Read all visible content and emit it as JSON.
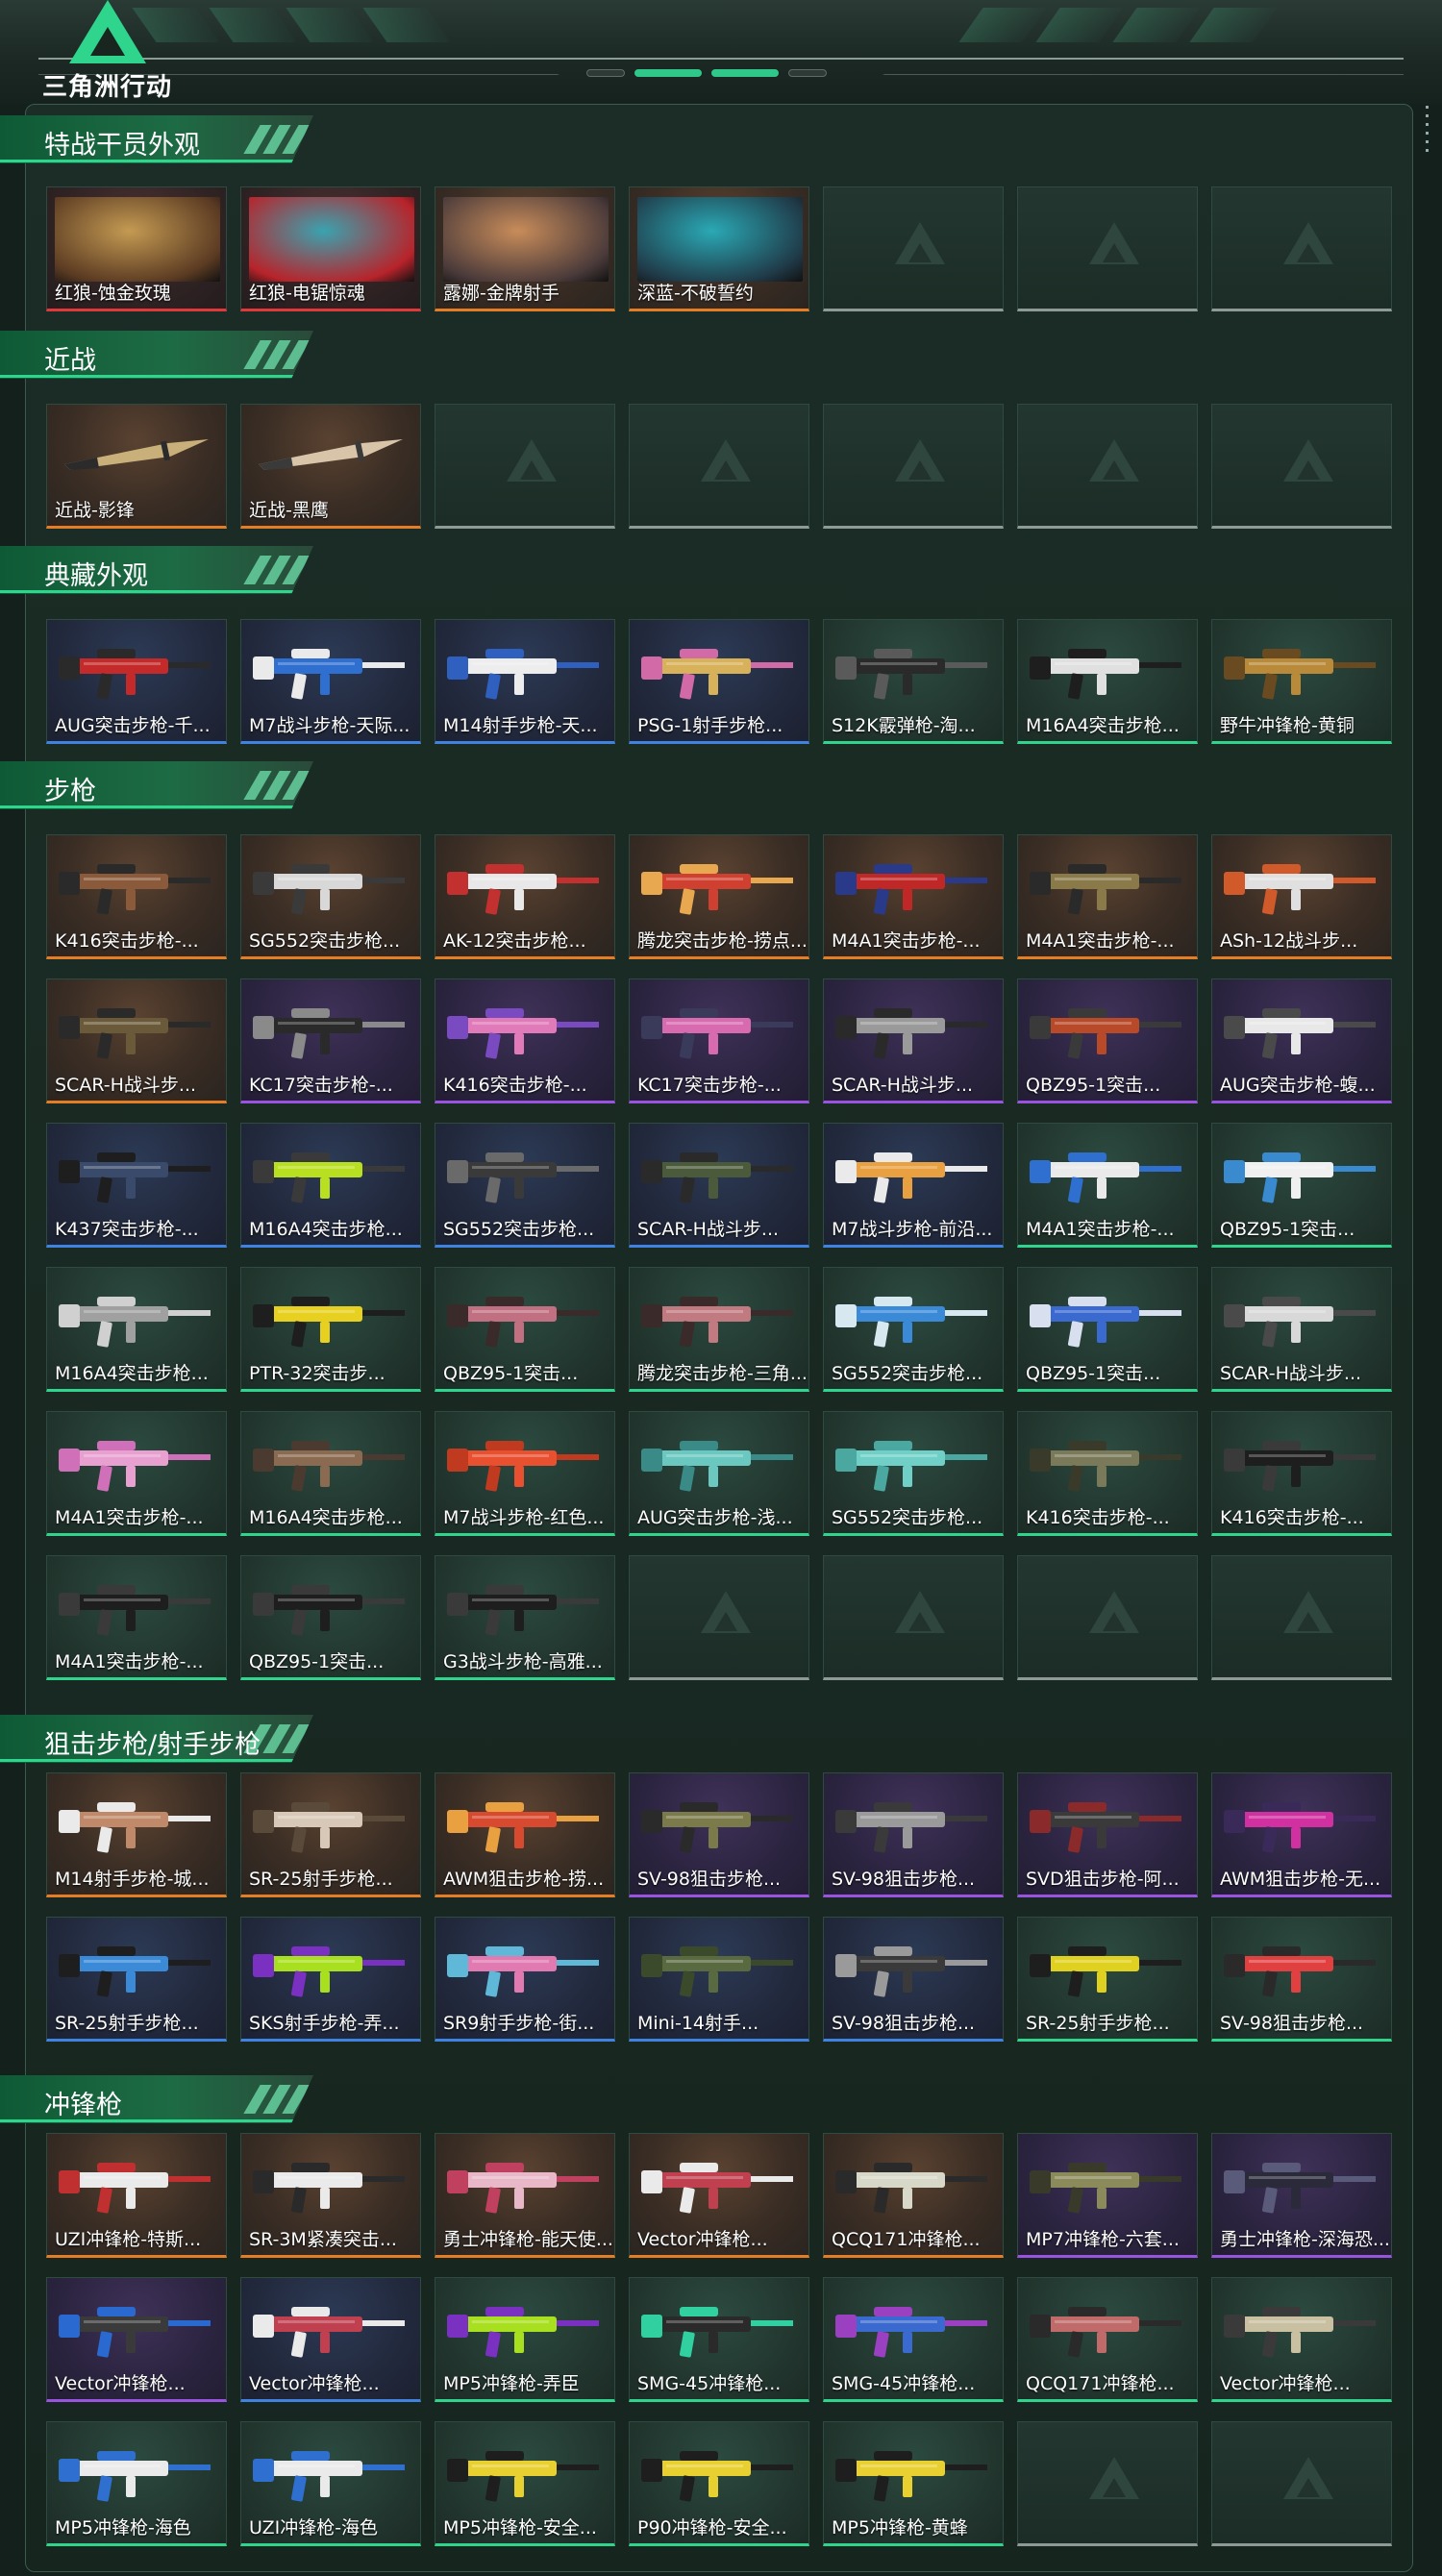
{
  "app": {
    "logo_text": "三角洲行动"
  },
  "sections": [
    {
      "title": "特战干员外观",
      "items": [
        {
          "label": "红狼-蚀金玫瑰",
          "rarity": "red",
          "kind": "operator",
          "colors": [
            "#c49a52",
            "#5a3a22"
          ]
        },
        {
          "label": "红狼-电锯惊魂",
          "rarity": "red",
          "kind": "operator",
          "colors": [
            "#3aa3b0",
            "#b8232a"
          ]
        },
        {
          "label": "露娜-金牌射手",
          "rarity": "orange",
          "kind": "operator",
          "colors": [
            "#c88c5a",
            "#4a3a3a"
          ]
        },
        {
          "label": "深蓝-不破誓约",
          "rarity": "orange",
          "kind": "operator",
          "colors": [
            "#2aa9b5",
            "#203a48"
          ]
        },
        {
          "label": "",
          "rarity": "empty"
        },
        {
          "label": "",
          "rarity": "empty"
        },
        {
          "label": "",
          "rarity": "empty"
        }
      ]
    },
    {
      "title": "近战",
      "items": [
        {
          "label": "近战-影锋",
          "rarity": "orange",
          "kind": "knife",
          "colors": [
            "#c9b07a",
            "#2b2b2b"
          ]
        },
        {
          "label": "近战-黑鹰",
          "rarity": "orange",
          "kind": "knife",
          "colors": [
            "#d8c4a8",
            "#3a3a3a"
          ]
        },
        {
          "label": "",
          "rarity": "empty"
        },
        {
          "label": "",
          "rarity": "empty"
        },
        {
          "label": "",
          "rarity": "empty"
        },
        {
          "label": "",
          "rarity": "empty"
        },
        {
          "label": "",
          "rarity": "empty"
        }
      ]
    },
    {
      "title": "典藏外观",
      "items": [
        {
          "label": "AUG突击步枪-千...",
          "rarity": "blue",
          "kind": "gun",
          "colors": [
            "#c42a2a",
            "#2a2a2a"
          ]
        },
        {
          "label": "M7战斗步枪-天际...",
          "rarity": "blue",
          "kind": "gun",
          "colors": [
            "#2f6fd0",
            "#eaeaea"
          ]
        },
        {
          "label": "M14射手步枪-天...",
          "rarity": "blue",
          "kind": "gun",
          "colors": [
            "#ededed",
            "#2f5fbf"
          ]
        },
        {
          "label": "PSG-1射手步枪...",
          "rarity": "blue",
          "kind": "gun",
          "colors": [
            "#d8b25a",
            "#d36aa8"
          ]
        },
        {
          "label": "S12K霰弹枪-淘...",
          "rarity": "green",
          "kind": "gun",
          "colors": [
            "#2a2a2a",
            "#5a5a5a"
          ]
        },
        {
          "label": "M16A4突击步枪...",
          "rarity": "green",
          "kind": "gun",
          "colors": [
            "#e0e0e0",
            "#1e1e1e"
          ]
        },
        {
          "label": "野牛冲锋枪-黄铜",
          "rarity": "green",
          "kind": "gun",
          "colors": [
            "#b88a3a",
            "#6a4a20"
          ]
        }
      ]
    },
    {
      "title": "步枪",
      "items": [
        {
          "label": "K416突击步枪-...",
          "rarity": "orange",
          "kind": "gun",
          "colors": [
            "#8a5a3a",
            "#2a2a2a"
          ]
        },
        {
          "label": "SG552突击步枪...",
          "rarity": "orange",
          "kind": "gun",
          "colors": [
            "#d8d8d8",
            "#3a3a3a"
          ]
        },
        {
          "label": "AK-12突击步枪...",
          "rarity": "orange",
          "kind": "gun",
          "colors": [
            "#e8e8e8",
            "#c23030"
          ]
        },
        {
          "label": "腾龙突击步枪-捞点...",
          "rarity": "orange",
          "kind": "gun",
          "colors": [
            "#d04030",
            "#e8a850"
          ]
        },
        {
          "label": "M4A1突击步枪-...",
          "rarity": "orange",
          "kind": "gun",
          "colors": [
            "#c02828",
            "#2a3a8a"
          ]
        },
        {
          "label": "M4A1突击步枪-...",
          "rarity": "orange",
          "kind": "gun",
          "colors": [
            "#8a7a4a",
            "#2a2a2a"
          ]
        },
        {
          "label": "ASh-12战斗步...",
          "rarity": "orange",
          "kind": "gun",
          "colors": [
            "#e0e0e0",
            "#d05a2a"
          ]
        },
        {
          "label": "SCAR-H战斗步...",
          "rarity": "orange",
          "kind": "gun",
          "colors": [
            "#6a5a3a",
            "#2a2a2a"
          ]
        },
        {
          "label": "KC17突击步枪-...",
          "rarity": "purple",
          "kind": "gun",
          "colors": [
            "#2a2a2a",
            "#8a8a8a"
          ]
        },
        {
          "label": "K416突击步枪-...",
          "rarity": "purple",
          "kind": "gun",
          "colors": [
            "#e07ab8",
            "#7a4ac0"
          ]
        },
        {
          "label": "KC17突击步枪-...",
          "rarity": "purple",
          "kind": "gun",
          "colors": [
            "#d86ab0",
            "#3a3a5a"
          ]
        },
        {
          "label": "SCAR-H战斗步...",
          "rarity": "purple",
          "kind": "gun",
          "colors": [
            "#9a9a9a",
            "#2a2a2a"
          ]
        },
        {
          "label": "QBZ95-1突击...",
          "rarity": "purple",
          "kind": "gun",
          "colors": [
            "#b84a2a",
            "#3a3a3a"
          ]
        },
        {
          "label": "AUG突击步枪-蝮...",
          "rarity": "purple",
          "kind": "gun",
          "colors": [
            "#e8e8e8",
            "#4a4a4a"
          ]
        },
        {
          "label": "K437突击步枪-...",
          "rarity": "blue",
          "kind": "gun",
          "colors": [
            "#3a4a6a",
            "#1e1e1e"
          ]
        },
        {
          "label": "M16A4突击步枪...",
          "rarity": "blue",
          "kind": "gun",
          "colors": [
            "#b8e020",
            "#3a3a3a"
          ]
        },
        {
          "label": "SG552突击步枪...",
          "rarity": "blue",
          "kind": "gun",
          "colors": [
            "#3a3a3a",
            "#6a6a6a"
          ]
        },
        {
          "label": "SCAR-H战斗步...",
          "rarity": "blue",
          "kind": "gun",
          "colors": [
            "#4a5a3a",
            "#2a2a2a"
          ]
        },
        {
          "label": "M7战斗步枪-前沿...",
          "rarity": "blue",
          "kind": "gun",
          "colors": [
            "#e8a040",
            "#eaeaea"
          ]
        },
        {
          "label": "M4A1突击步枪-...",
          "rarity": "green",
          "kind": "gun",
          "colors": [
            "#eaeaea",
            "#2f6fd0"
          ]
        },
        {
          "label": "QBZ95-1突击...",
          "rarity": "green",
          "kind": "gun",
          "colors": [
            "#f0f0f0",
            "#3a8ad0"
          ]
        },
        {
          "label": "M16A4突击步枪...",
          "rarity": "green",
          "kind": "gun",
          "colors": [
            "#a0a0a0",
            "#d0d0d0"
          ]
        },
        {
          "label": "PTR-32突击步...",
          "rarity": "green",
          "kind": "gun",
          "colors": [
            "#e8d020",
            "#1e1e1e"
          ]
        },
        {
          "label": "QBZ95-1突击...",
          "rarity": "green",
          "kind": "gun",
          "colors": [
            "#c07080",
            "#3a2a2a"
          ]
        },
        {
          "label": "腾龙突击步枪-三角...",
          "rarity": "green",
          "kind": "gun",
          "colors": [
            "#c07a80",
            "#3a2a2a"
          ]
        },
        {
          "label": "SG552突击步枪...",
          "rarity": "green",
          "kind": "gun",
          "colors": [
            "#3a8ad8",
            "#d8e8f0"
          ]
        },
        {
          "label": "QBZ95-1突击...",
          "rarity": "green",
          "kind": "gun",
          "colors": [
            "#3a6ad0",
            "#d8e0f0"
          ]
        },
        {
          "label": "SCAR-H战斗步...",
          "rarity": "green",
          "kind": "gun",
          "colors": [
            "#d8d8d8",
            "#4a4a4a"
          ]
        },
        {
          "label": "M4A1突击步枪-...",
          "rarity": "green",
          "kind": "gun",
          "colors": [
            "#e8a0d0",
            "#d070b8"
          ]
        },
        {
          "label": "M16A4突击步枪...",
          "rarity": "green",
          "kind": "gun",
          "colors": [
            "#8a6a50",
            "#4a3a30"
          ]
        },
        {
          "label": "M7战斗步枪-红色...",
          "rarity": "green",
          "kind": "gun",
          "colors": [
            "#e85030",
            "#c03a20"
          ]
        },
        {
          "label": "AUG突击步枪-浅...",
          "rarity": "green",
          "kind": "gun",
          "colors": [
            "#6ac8c0",
            "#3a8a88"
          ]
        },
        {
          "label": "SG552突击步枪...",
          "rarity": "green",
          "kind": "gun",
          "colors": [
            "#70d0c8",
            "#4aa8a0"
          ]
        },
        {
          "label": "K416突击步枪-...",
          "rarity": "green",
          "kind": "gun",
          "colors": [
            "#7a7a5a",
            "#3a3a2a"
          ]
        },
        {
          "label": "K416突击步枪-...",
          "rarity": "green",
          "kind": "gun",
          "colors": [
            "#1e1e1e",
            "#3a3a3a"
          ]
        },
        {
          "label": "M4A1突击步枪-...",
          "rarity": "green",
          "kind": "gun",
          "colors": [
            "#1e1e1e",
            "#3a3a3a"
          ]
        },
        {
          "label": "QBZ95-1突击...",
          "rarity": "green",
          "kind": "gun",
          "colors": [
            "#1e1e1e",
            "#3a3a3a"
          ]
        },
        {
          "label": "G3战斗步枪-高雅...",
          "rarity": "green",
          "kind": "gun",
          "colors": [
            "#1e1e1e",
            "#3a3a3a"
          ]
        },
        {
          "label": "",
          "rarity": "empty"
        },
        {
          "label": "",
          "rarity": "empty"
        },
        {
          "label": "",
          "rarity": "empty"
        },
        {
          "label": "",
          "rarity": "empty"
        }
      ]
    },
    {
      "title": "狙击步枪/射手步枪",
      "items": [
        {
          "label": "M14射手步枪-城...",
          "rarity": "orange",
          "kind": "gun",
          "colors": [
            "#c08a6a",
            "#eaeaea"
          ]
        },
        {
          "label": "SR-25射手步枪...",
          "rarity": "orange",
          "kind": "gun",
          "colors": [
            "#d8c8b8",
            "#5a4a3a"
          ]
        },
        {
          "label": "AWM狙击步枪-捞...",
          "rarity": "orange",
          "kind": "gun",
          "colors": [
            "#d84a30",
            "#e8a040"
          ]
        },
        {
          "label": "SV-98狙击步枪...",
          "rarity": "purple",
          "kind": "gun",
          "colors": [
            "#7a7a4a",
            "#2a2a2a"
          ]
        },
        {
          "label": "SV-98狙击步枪...",
          "rarity": "purple",
          "kind": "gun",
          "colors": [
            "#9a9a9a",
            "#3a3a3a"
          ]
        },
        {
          "label": "SVD狙击步枪-阿...",
          "rarity": "purple",
          "kind": "gun",
          "colors": [
            "#3a3a3a",
            "#8a2a2a"
          ]
        },
        {
          "label": "AWM狙击步枪-无...",
          "rarity": "purple",
          "kind": "gun",
          "colors": [
            "#d030a0",
            "#3a2a5a"
          ]
        },
        {
          "label": "SR-25射手步枪...",
          "rarity": "blue",
          "kind": "gun",
          "colors": [
            "#3a8ad8",
            "#1e1e1e"
          ]
        },
        {
          "label": "SKS射手步枪-弄...",
          "rarity": "blue",
          "kind": "gun",
          "colors": [
            "#a8e020",
            "#7a30c0"
          ]
        },
        {
          "label": "SR9射手步枪-街...",
          "rarity": "blue",
          "kind": "gun",
          "colors": [
            "#e07ab0",
            "#60b8d8"
          ]
        },
        {
          "label": "Mini-14射手...",
          "rarity": "blue",
          "kind": "gun",
          "colors": [
            "#5a6a40",
            "#3a4a2a"
          ]
        },
        {
          "label": "SV-98狙击步枪...",
          "rarity": "blue",
          "kind": "gun",
          "colors": [
            "#3a3a3a",
            "#9a9a9a"
          ]
        },
        {
          "label": "SR-25射手步枪...",
          "rarity": "green",
          "kind": "gun",
          "colors": [
            "#e0d020",
            "#1e1e1e"
          ]
        },
        {
          "label": "SV-98狙击步枪...",
          "rarity": "green",
          "kind": "gun",
          "colors": [
            "#e04040",
            "#2a2a2a"
          ]
        }
      ]
    },
    {
      "title": "冲锋枪",
      "items": [
        {
          "label": "UZI冲锋枪-特斯...",
          "rarity": "orange",
          "kind": "gun",
          "colors": [
            "#eaeaea",
            "#c03030"
          ]
        },
        {
          "label": "SR-3M紧凑突击...",
          "rarity": "orange",
          "kind": "gun",
          "colors": [
            "#eaeaea",
            "#2a2a2a"
          ]
        },
        {
          "label": "勇士冲锋枪-能天使...",
          "rarity": "orange",
          "kind": "gun",
          "colors": [
            "#e8b8c8",
            "#c04060"
          ]
        },
        {
          "label": "Vector冲锋枪...",
          "rarity": "orange",
          "kind": "gun",
          "colors": [
            "#c04050",
            "#eaeaea"
          ]
        },
        {
          "label": "QCQ171冲锋枪...",
          "rarity": "orange",
          "kind": "gun",
          "colors": [
            "#d8d8c8",
            "#2a2a2a"
          ]
        },
        {
          "label": "MP7冲锋枪-六套...",
          "rarity": "purple",
          "kind": "gun",
          "colors": [
            "#8a8a5a",
            "#3a3a2a"
          ]
        },
        {
          "label": "勇士冲锋枪-深海恐...",
          "rarity": "purple",
          "kind": "gun",
          "colors": [
            "#2a2a3a",
            "#5a5a7a"
          ]
        },
        {
          "label": "Vector冲锋枪...",
          "rarity": "purple",
          "kind": "gun",
          "colors": [
            "#3a3a3a",
            "#2a6ad0"
          ]
        },
        {
          "label": "Vector冲锋枪...",
          "rarity": "blue",
          "kind": "gun",
          "colors": [
            "#c04050",
            "#eaeaea"
          ]
        },
        {
          "label": "MP5冲锋枪-弄臣",
          "rarity": "green",
          "kind": "gun",
          "colors": [
            "#a8e020",
            "#7a30c0"
          ]
        },
        {
          "label": "SMG-45冲锋枪...",
          "rarity": "green",
          "kind": "gun",
          "colors": [
            "#2a2a2a",
            "#30d0a0"
          ]
        },
        {
          "label": "SMG-45冲锋枪...",
          "rarity": "green",
          "kind": "gun",
          "colors": [
            "#3a6ad0",
            "#9a40c0"
          ]
        },
        {
          "label": "QCQ171冲锋枪...",
          "rarity": "green",
          "kind": "gun",
          "colors": [
            "#c06a6a",
            "#2a2a2a"
          ]
        },
        {
          "label": "Vector冲锋枪...",
          "rarity": "green",
          "kind": "gun",
          "colors": [
            "#c8c0a0",
            "#3a3a3a"
          ]
        },
        {
          "label": "MP5冲锋枪-海色",
          "rarity": "green",
          "kind": "gun",
          "colors": [
            "#eaeaea",
            "#2f6fd0"
          ]
        },
        {
          "label": "UZI冲锋枪-海色",
          "rarity": "green",
          "kind": "gun",
          "colors": [
            "#eaeaea",
            "#2f6fd0"
          ]
        },
        {
          "label": "MP5冲锋枪-安全...",
          "rarity": "green",
          "kind": "gun",
          "colors": [
            "#e8d030",
            "#1e1e1e"
          ]
        },
        {
          "label": "P90冲锋枪-安全...",
          "rarity": "green",
          "kind": "gun",
          "colors": [
            "#e8d030",
            "#1e1e1e"
          ]
        },
        {
          "label": "MP5冲锋枪-黄蜂",
          "rarity": "green",
          "kind": "gun",
          "colors": [
            "#e8d030",
            "#1e1e1e"
          ]
        },
        {
          "label": "",
          "rarity": "empty"
        },
        {
          "label": "",
          "rarity": "empty"
        }
      ]
    }
  ]
}
